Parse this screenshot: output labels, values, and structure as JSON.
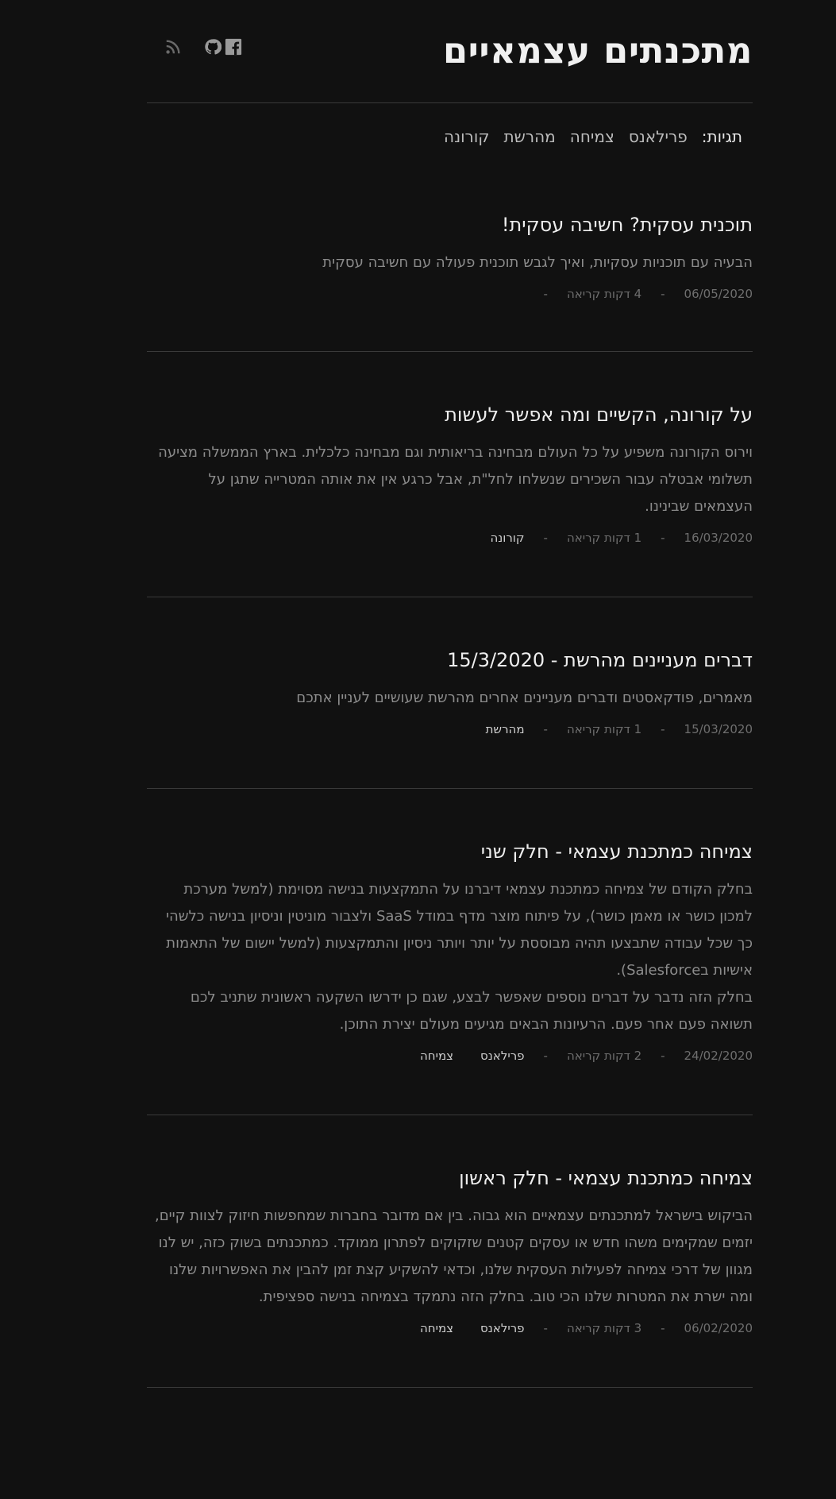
{
  "site": {
    "title": "מתכנתים עצמאיים",
    "social_icons": [
      "facebook-icon",
      "github-icon",
      "rss-icon"
    ]
  },
  "nav": {
    "label": "תגיות:",
    "tags": [
      "פרילאנס",
      "צמיחה",
      "מהרשת",
      "קורונה"
    ]
  },
  "meta_separator": "-",
  "posts": [
    {
      "title": "תוכנית עסקית? חשיבה עסקית!",
      "excerpt": "הבעיה עם תוכניות עסקיות, ואיך לגבש תוכנית פעולה עם חשיבה עסקית",
      "date": "06/05/2020",
      "read_time": "4 דקות קריאה",
      "tags": []
    },
    {
      "title": "על קורונה, הקשיים ומה אפשר לעשות",
      "excerpt": "וירוס הקורונה משפיע על כל העולם מבחינה בריאותית וגם מבחינה כלכלית. בארץ הממשלה מציעה תשלומי אבטלה עבור השכירים שנשלחו לחל\"ת, אבל כרגע אין את אותה המטרייה שתגן על העצמאים שבינינו.",
      "date": "16/03/2020",
      "read_time": "1 דקות קריאה",
      "tags": [
        "קורונה"
      ]
    },
    {
      "title": "דברים מעניינים מהרשת - 15/3/2020",
      "excerpt": "מאמרים, פודקאסטים ודברים מעניינים אחרים מהרשת שעושיים לעניין אתכם",
      "date": "15/03/2020",
      "read_time": "1 דקות קריאה",
      "tags": [
        "מהרשת"
      ]
    },
    {
      "title": "צמיחה כמתכנת עצמאי - חלק שני",
      "excerpt": "בחלק הקודם של צמיחה כמתכנת עצמאי דיברנו על התמקצעות בנישה מסוימת (למשל מערכת למכון כושר או מאמן כושר), על פיתוח מוצר מדף במודל SaaS ולצבור מוניטין וניסיון בנישה כלשהי כך שכל עבודה שתבצעו תהיה מבוססת על יותר ויותר ניסיון והתמקצעות (למשל יישום של התאמות אישיות בSalesforce).",
      "excerpt2": "בחלק הזה נדבר על דברים נוספים שאפשר לבצע, שגם כן ידרשו השקעה ראשונית שתניב לכם תשואה פעם אחר פעם. הרעיונות הבאים מגיעים מעולם יצירת התוכן.",
      "date": "24/02/2020",
      "read_time": "2 דקות קריאה",
      "tags": [
        "פרילאנס",
        "צמיחה"
      ]
    },
    {
      "title": "צמיחה כמתכנת עצמאי - חלק ראשון",
      "excerpt": "הביקוש בישראל למתכנתים עצמאיים הוא גבוה. בין אם מדובר בחברות שמחפשות חיזוק לצוות קיים, יזמים שמקימים משהו חדש או עסקים קטנים שזקוקים לפתרון ממוקד. כמתכנתים בשוק כזה, יש לנו מגוון של דרכי צמיחה לפעילות העסקית שלנו, וכדאי להשקיע קצת זמן להבין את האפשרויות שלנו ומה ישרת את המטרות שלנו הכי טוב. בחלק הזה נתמקד בצמיחה בנישה ספציפית.",
      "date": "06/02/2020",
      "read_time": "3 דקות קריאה",
      "tags": [
        "פרילאנס",
        "צמיחה"
      ]
    }
  ]
}
